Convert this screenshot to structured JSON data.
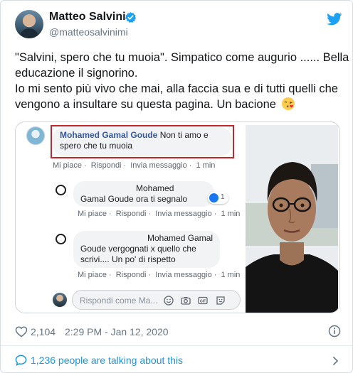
{
  "author": {
    "name": "Matteo Salvini",
    "handle": "@matteosalvinimi"
  },
  "tweet": {
    "lines": [
      "\"Salvini, spero che tu muoia\". Simpatico come augurio ...... Bella",
      "educazione il signorino.",
      "Io mi sento più vivo che mai, alla faccia sua e di tutti quelli che",
      "vengono a insultare su questa pagina. Un bacione"
    ]
  },
  "screenshot": {
    "main_comment": {
      "name": "Mohamed Gamal Goude",
      "text_line1": " Non ti amo e",
      "text_line2": "spero che tu muoia",
      "actions": [
        "Mi piace",
        "·",
        "Rispondi",
        "·",
        "Invia messaggio",
        "·",
        "1 min"
      ]
    },
    "reply1": {
      "line1": "Mohamed",
      "line2": "Gamal Goude ora ti segnalo",
      "reaction_count": "1",
      "actions": [
        "Mi piace",
        "·",
        "Rispondi",
        "·",
        "Invia messaggio",
        "·",
        "1 min"
      ]
    },
    "reply2": {
      "line1": "Mohamed Gamal",
      "line2": "Goude vergognati x quello che",
      "line3": "scrivi.... Un po' di rispetto",
      "actions": [
        "Mi piace",
        "·",
        "Rispondi",
        "·",
        "Invia messaggio",
        "·",
        "1 min"
      ]
    },
    "reply_box": {
      "placeholder": "Rispondi come Ma..."
    }
  },
  "footer": {
    "likes": "2,104",
    "time": "2:29 PM - Jan 12, 2020",
    "talking": "1,236 people are talking about this"
  },
  "colors": {
    "twitter_blue": "#1da1f2",
    "link_blue": "#1b95e0",
    "fb_name": "#385898",
    "highlight_red": "#c1272d"
  }
}
